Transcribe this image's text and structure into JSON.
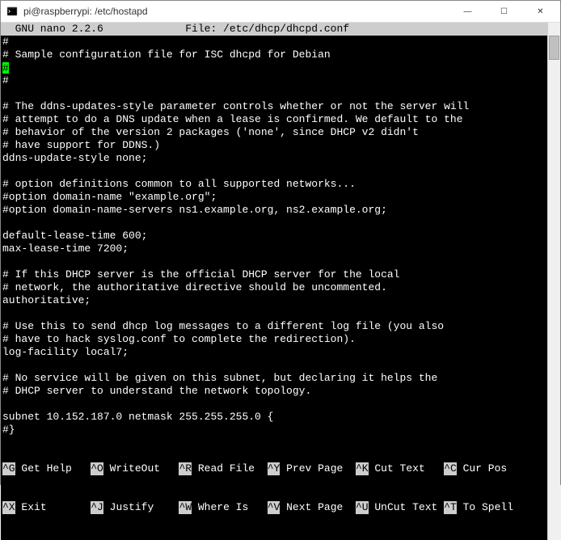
{
  "window": {
    "title": "pi@raspberrypi: /etc/hostapd",
    "icon": "terminal-icon"
  },
  "controls": {
    "minimize": "—",
    "maximize": "☐",
    "close": "✕"
  },
  "nano": {
    "header_left": "  GNU nano 2.2.6",
    "header_file": "File: /etc/dhcp/dhcpd.conf"
  },
  "file_lines": [
    "#",
    "# Sample configuration file for ISC dhcpd for Debian",
    "",
    "#",
    "",
    "# The ddns-updates-style parameter controls whether or not the server will",
    "# attempt to do a DNS update when a lease is confirmed. We default to the",
    "# behavior of the version 2 packages ('none', since DHCP v2 didn't",
    "# have support for DDNS.)",
    "ddns-update-style none;",
    "",
    "# option definitions common to all supported networks...",
    "#option domain-name \"example.org\";",
    "#option domain-name-servers ns1.example.org, ns2.example.org;",
    "",
    "default-lease-time 600;",
    "max-lease-time 7200;",
    "",
    "# If this DHCP server is the official DHCP server for the local",
    "# network, the authoritative directive should be uncommented.",
    "authoritative;",
    "",
    "# Use this to send dhcp log messages to a different log file (you also",
    "# have to hack syslog.conf to complete the redirection).",
    "log-facility local7;",
    "",
    "# No service will be given on this subnet, but declaring it helps the",
    "# DHCP server to understand the network topology.",
    "",
    "subnet 10.152.187.0 netmask 255.255.255.0 {",
    "#}"
  ],
  "cursor_line_index": 2,
  "help": {
    "row1": [
      {
        "key": "^G",
        "label": " Get Help"
      },
      {
        "key": "^O",
        "label": " WriteOut"
      },
      {
        "key": "^R",
        "label": " Read File"
      },
      {
        "key": "^Y",
        "label": " Prev Page"
      },
      {
        "key": "^K",
        "label": " Cut Text"
      },
      {
        "key": "^C",
        "label": " Cur Pos"
      }
    ],
    "row2": [
      {
        "key": "^X",
        "label": " Exit"
      },
      {
        "key": "^J",
        "label": " Justify"
      },
      {
        "key": "^W",
        "label": " Where Is"
      },
      {
        "key": "^V",
        "label": " Next Page"
      },
      {
        "key": "^U",
        "label": " UnCut Text"
      },
      {
        "key": "^T",
        "label": " To Spell"
      }
    ]
  }
}
